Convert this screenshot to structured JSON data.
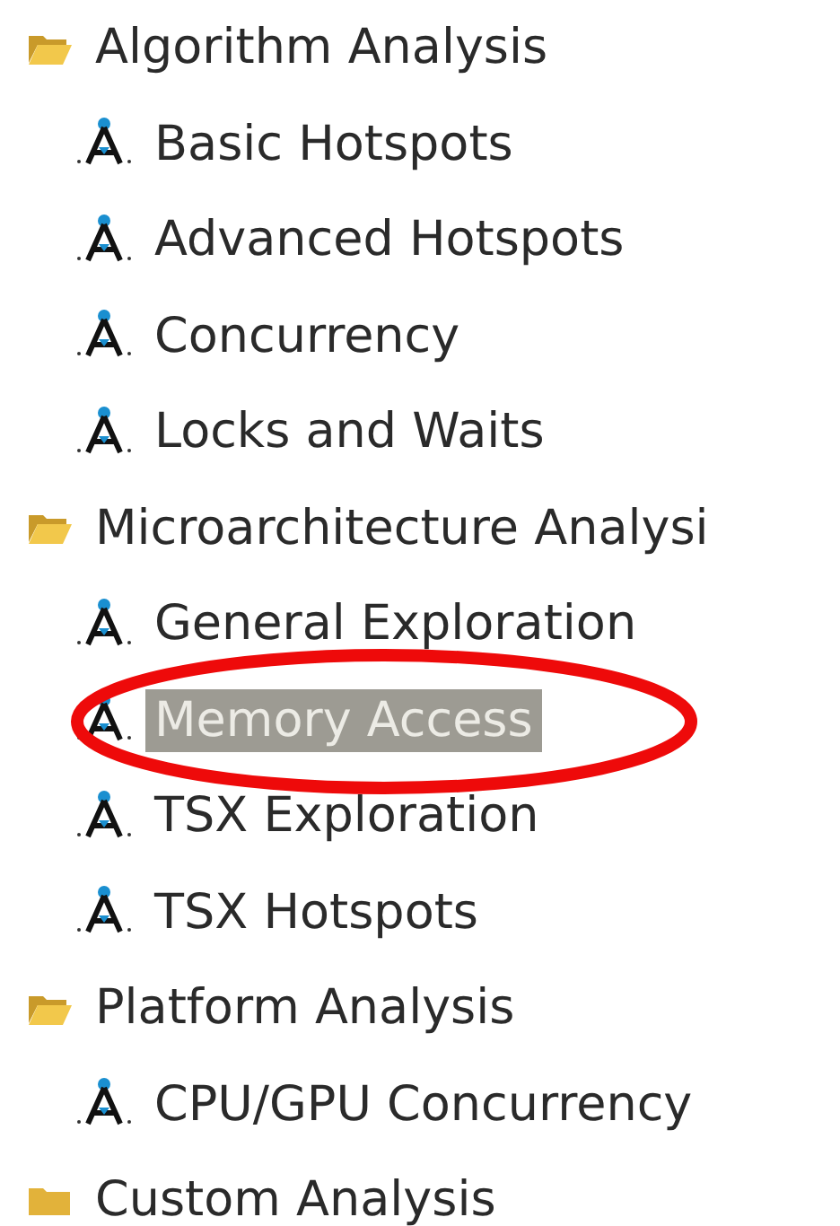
{
  "tree": [
    {
      "label": "Algorithm Analysis",
      "expanded": true,
      "children": [
        {
          "label": "Basic Hotspots",
          "selected": false,
          "circled": false
        },
        {
          "label": "Advanced Hotspots",
          "selected": false,
          "circled": false
        },
        {
          "label": "Concurrency",
          "selected": false,
          "circled": false
        },
        {
          "label": "Locks and Waits",
          "selected": false,
          "circled": false
        }
      ]
    },
    {
      "label": "Microarchitecture Analysi",
      "expanded": true,
      "children": [
        {
          "label": "General Exploration",
          "selected": false,
          "circled": false
        },
        {
          "label": "Memory Access",
          "selected": true,
          "circled": true
        },
        {
          "label": "TSX Exploration",
          "selected": false,
          "circled": false
        },
        {
          "label": "TSX Hotspots",
          "selected": false,
          "circled": false
        }
      ]
    },
    {
      "label": "Platform Analysis",
      "expanded": true,
      "children": [
        {
          "label": "CPU/GPU Concurrency",
          "selected": false,
          "circled": false
        }
      ]
    },
    {
      "label": "Custom Analysis",
      "expanded": false
    }
  ]
}
